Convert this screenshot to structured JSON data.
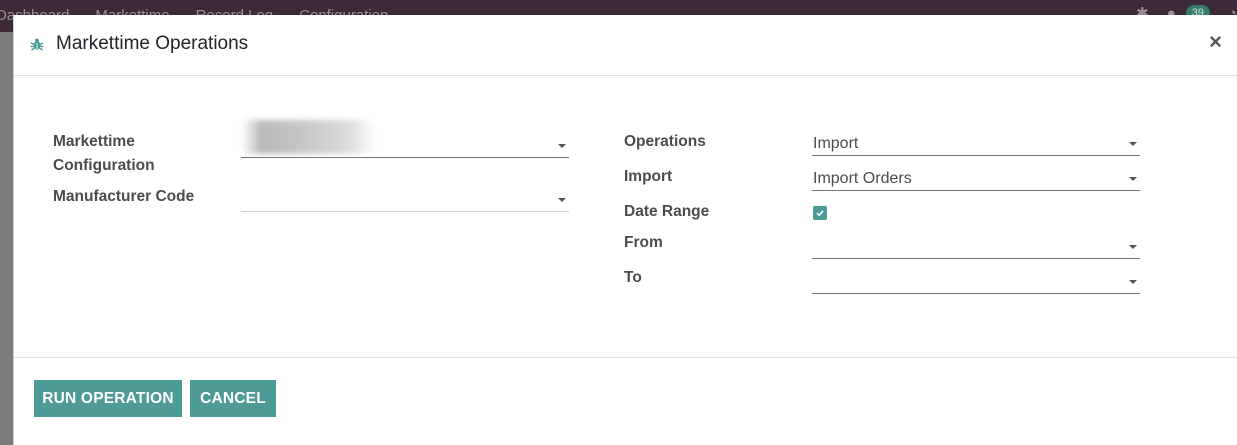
{
  "navbar": {
    "menu": [
      "Dashboard",
      "Markettime",
      "Record Log",
      "Configuration"
    ],
    "messages_count": "39"
  },
  "modal": {
    "title": "Markettime Operations",
    "close_label": "×",
    "left": {
      "config_label": "Markettime Configuration",
      "config_value": "",
      "manufacturer_label": "Manufacturer Code",
      "manufacturer_value": ""
    },
    "right": {
      "operations_label": "Operations",
      "operations_value": "Import",
      "import_label": "Import",
      "import_value": "Import Orders",
      "date_range_label": "Date Range",
      "date_range_checked": true,
      "from_label": "From",
      "from_value": "",
      "to_label": "To",
      "to_value": ""
    },
    "footer": {
      "run_label": "RUN OPERATION",
      "cancel_label": "CANCEL"
    }
  },
  "colors": {
    "accent": "#4d9a96",
    "navbar": "#3d2a38"
  },
  "icons": {
    "title_icon": "bug-icon",
    "close_icon": "close-icon",
    "checkbox_icon": "check-icon",
    "dropdown_icon": "caret-down-icon"
  }
}
